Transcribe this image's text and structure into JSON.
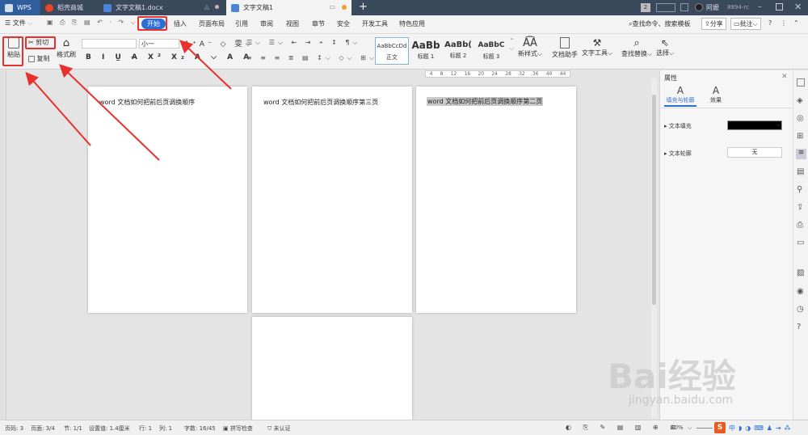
{
  "titlebar": {
    "tabs": [
      {
        "label": "WPS"
      },
      {
        "label": "稻壳商城"
      },
      {
        "label": "文字文稿1.docx"
      },
      {
        "label": "文字文稿1"
      }
    ],
    "user": "阿嬷",
    "user_id": "8894-rc",
    "badge": "2"
  },
  "menubar": {
    "file": "文件",
    "items": [
      "开始",
      "插入",
      "页面布局",
      "引用",
      "审阅",
      "视图",
      "章节",
      "安全",
      "开发工具",
      "特色应用"
    ],
    "search": "查找命令、搜索模板",
    "share": "分享",
    "comment": "批注"
  },
  "toolbar": {
    "paste": "粘贴",
    "cut": "剪切",
    "copy": "复制",
    "format_painter": "格式刷",
    "font_size": "小一",
    "styles": [
      {
        "preview": "AaBbCcDd",
        "label": "正文"
      },
      {
        "preview": "AaBb",
        "label": "标题 1"
      },
      {
        "preview": "AaBb(",
        "label": "标题 2"
      },
      {
        "preview": "AaBbC",
        "label": "标题 3"
      }
    ],
    "new_style": "新样式",
    "doc_helper": "文档助手",
    "text_tools": "文字工具",
    "find_replace": "查找替换",
    "select": "选择"
  },
  "ruler": {
    "ticks": [
      "4",
      "8",
      "12",
      "16",
      "20",
      "24",
      "28",
      "32",
      "36",
      "40",
      "44"
    ]
  },
  "pages": [
    {
      "text": "word 文档如何把前后页调换顺序"
    },
    {
      "text": "word 文档如何把前后页调换顺序第三页"
    },
    {
      "text": "word 文档如何把前后页调换顺序第二页"
    },
    {
      "text": ""
    }
  ],
  "properties": {
    "title": "属性",
    "tab_fill": "填充与轮廓",
    "tab_effect": "效果",
    "text_fill": "文本填充",
    "text_outline": "文本轮廓",
    "outline_value": "无"
  },
  "status": {
    "page_num": "页码: 3",
    "page": "页面: 3/4",
    "section": "节: 1/1",
    "setting": "设置值: 1.4厘米",
    "row": "行: 1",
    "col": "列: 1",
    "words": "字数: 16/45",
    "spell": "拼写检查",
    "auth": "未认证",
    "zoom": "40%"
  },
  "watermark": {
    "text": "Bai经验",
    "url": "jingyan.baidu.com"
  },
  "colors": {
    "accent": "#2a6fd4",
    "annotation": "#e8312f",
    "titlebar": "#3a4a5c"
  }
}
